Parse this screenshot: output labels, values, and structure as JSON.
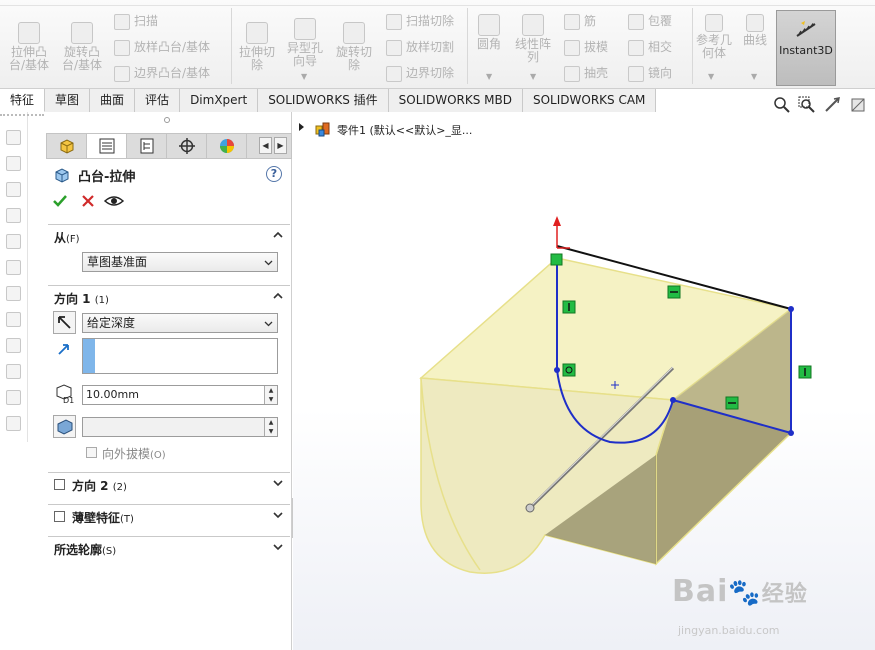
{
  "ribbon": {
    "extrude_boss": "拉伸凸台/基体",
    "revolve_boss": "旋转凸台/基体",
    "sweep": "扫描",
    "loft_boss": "放样凸台/基体",
    "boundary_boss": "边界凸台/基体",
    "extrude_cut": "拉伸切除",
    "hole_wizard": "异型孔向导",
    "revolve_cut": "旋转切除",
    "sweep_cut": "扫描切除",
    "loft_cut": "放样切割",
    "boundary_cut": "边界切除",
    "fillet": "圆角",
    "linear_pattern": "线性阵列",
    "rib": "筋",
    "draft": "拔模",
    "shell": "抽壳",
    "wrap": "包覆",
    "intersect": "相交",
    "mirror": "镜向",
    "reference_geometry": "参考几何体",
    "curves": "曲线",
    "instant3d": "Instant3D"
  },
  "tabs": [
    "特征",
    "草图",
    "曲面",
    "评估",
    "DimXpert",
    "SOLIDWORKS 插件",
    "SOLIDWORKS MBD",
    "SOLIDWORKS CAM"
  ],
  "property_manager": {
    "title": "凸台-拉伸",
    "help": "?",
    "from": {
      "label": "从",
      "shortcut": "(F)",
      "value": "草图基准面"
    },
    "direction1": {
      "label": "方向 1",
      "shortcut": "(1)",
      "end_condition": "给定深度",
      "depth": "10.00mm",
      "draft_outward": "向外拔模",
      "draft_shortcut": "(O)"
    },
    "direction2": {
      "label": "方向 2",
      "shortcut": "(2)"
    },
    "thin_feature": {
      "label": "薄壁特征",
      "shortcut": "(T)"
    },
    "selected_contours": {
      "label": "所选轮廓",
      "shortcut": "(S)"
    }
  },
  "tree": {
    "part_name": "零件1  (默认<<默认>_显..."
  },
  "watermark": {
    "logo": "Bai",
    "logo2": "经验",
    "url": "jingyan.baidu.com"
  },
  "colors": {
    "accent_blue": "#1f2fc8",
    "model_fill": "#f2efb0",
    "model_edge": "#e5e07a",
    "dimension_red": "#e02020",
    "relation_green": "#22bb44"
  }
}
